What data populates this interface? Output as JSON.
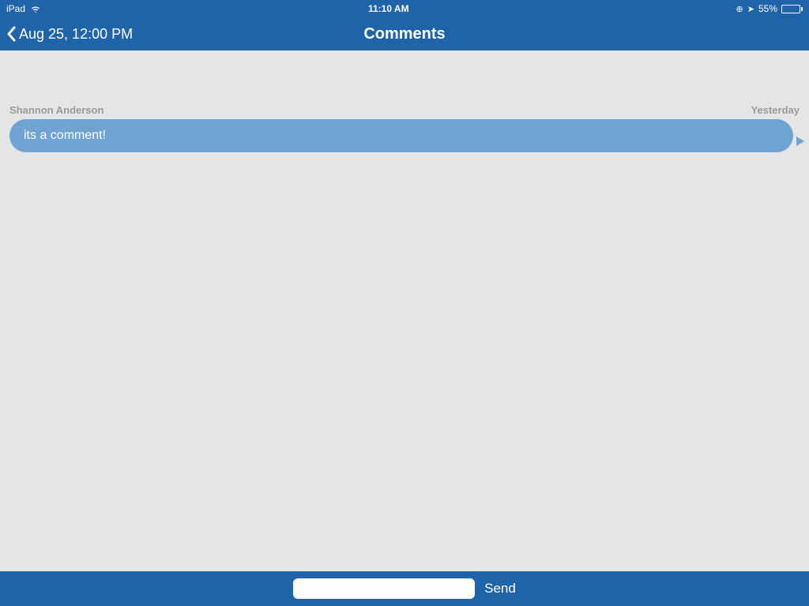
{
  "status_bar": {
    "device": "iPad",
    "time": "11:10 AM",
    "battery_pct": "55%",
    "lock_glyph": "⊕",
    "location_glyph": "➤"
  },
  "nav": {
    "back_label": "Aug 25, 12:00 PM",
    "title": "Comments"
  },
  "comments": [
    {
      "author": "Shannon Anderson",
      "time_label": "Yesterday",
      "text": "its a comment!"
    }
  ],
  "input": {
    "value": "",
    "send_label": "Send"
  }
}
